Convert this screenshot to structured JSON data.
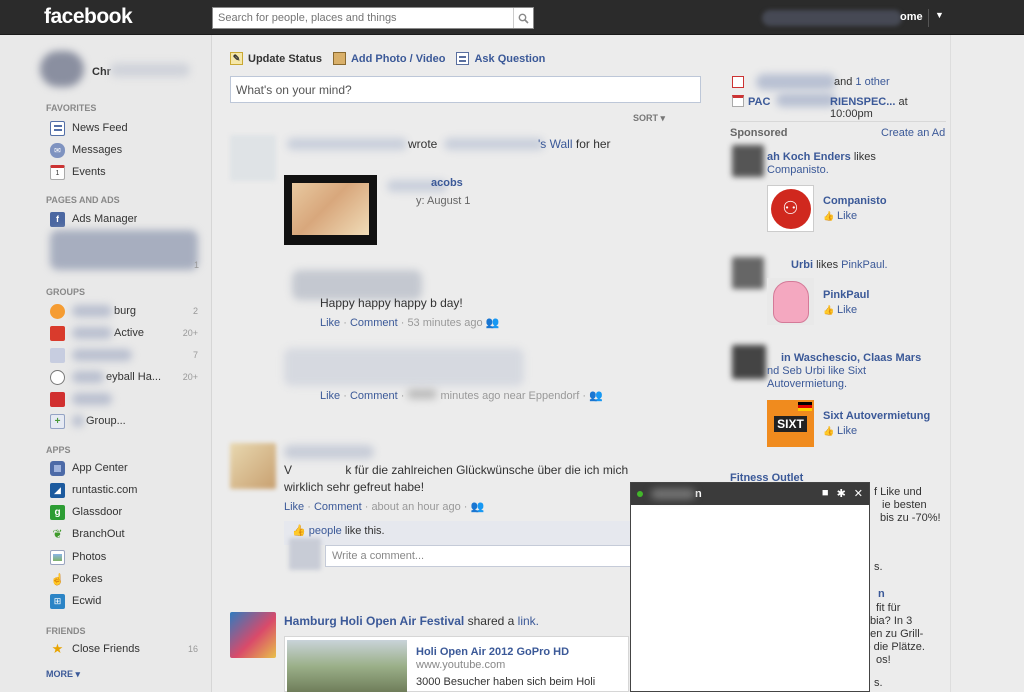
{
  "header": {
    "logo": "facebook",
    "search_placeholder": "Search for people, places and things",
    "home_label": "ome"
  },
  "profile": {
    "name_fragment": "Chr"
  },
  "sidebar": {
    "favorites_head": "FAVORITES",
    "favorites": [
      {
        "label": "News Feed"
      },
      {
        "label": "Messages"
      },
      {
        "label": "Events"
      }
    ],
    "pages_head": "PAGES AND ADS",
    "ads_manager": "Ads Manager",
    "pages_count": "1",
    "groups_head": "GROUPS",
    "groups": [
      {
        "label": "burg",
        "count": "2"
      },
      {
        "label": "Active",
        "count": "20+"
      },
      {
        "label": "",
        "count": "7"
      },
      {
        "label": "eyball Ha...",
        "count": "20+"
      },
      {
        "label": "",
        "count": ""
      },
      {
        "label": "Group...",
        "count": ""
      }
    ],
    "apps_head": "APPS",
    "apps": [
      {
        "label": "App Center"
      },
      {
        "label": "runtastic.com"
      },
      {
        "label": "Glassdoor"
      },
      {
        "label": "BranchOut"
      },
      {
        "label": "Photos"
      },
      {
        "label": "Pokes"
      },
      {
        "label": "Ecwid"
      }
    ],
    "friends_head": "FRIENDS",
    "friends": [
      {
        "label": "Close Friends",
        "count": "16"
      }
    ],
    "more": "MORE"
  },
  "composer": {
    "update_status": "Update Status",
    "add_photo": "Add Photo / Video",
    "ask_question": "Ask Question",
    "placeholder": "What's on your mind?",
    "sort": "SORT"
  },
  "feed": {
    "post1": {
      "wrote": "wrote",
      "wall_suffix": "'s Wall",
      "for_her": "for her",
      "name_fragment": "acobs",
      "bday_fragment": "y: August 1",
      "message": "Happy happy happy b day!",
      "like": "Like",
      "comment": "Comment",
      "time": "53 minutes ago",
      "like2": "Like",
      "comment2": "Comment",
      "time2": "minutes ago near Eppendorf"
    },
    "post2": {
      "message_line1": "V                k für die zahlreichen Glückwünsche über die ich mich",
      "message_line2": "wirklich sehr gefreut habe!",
      "like": "Like",
      "comment": "Comment",
      "time": "about an hour ago",
      "people_like": "people",
      "like_this": "like this.",
      "write_comment": "Write a comment..."
    },
    "post3": {
      "page": "Hamburg Holi Open Air Festival",
      "shared": "shared a",
      "link": "link.",
      "link_title": "Holi Open Air 2012 GoPro HD",
      "link_site": "www.youtube.com",
      "link_desc": "3000 Besucher haben sich beim Holi"
    }
  },
  "right": {
    "event1": "and",
    "event1_link": "1 other",
    "event2": "PAC",
    "event2_rest": "RIENSPEC...",
    "event2_time": "at 10:00pm",
    "sponsored": "Sponsored",
    "create_ad": "Create an Ad",
    "ad1_who": "ah Koch Enders",
    "ad1_likes": "likes",
    "ad1_page": "Companisto.",
    "ad1_title": "Companisto",
    "ad1_like": "Like",
    "ad2_who": "Urbi",
    "ad2_likes": "likes",
    "ad2_page": "PinkPaul.",
    "ad2_title": "PinkPaul",
    "ad2_like": "Like",
    "ad3_line1": "in Waschescio, Claas Mars",
    "ad3_line2": "nd Seb Urbi like Sixt",
    "ad3_line3": "Autovermietung.",
    "ad3_title": "Sixt Autovermietung",
    "ad3_like": "Like",
    "fitness": "Fitness Outlet",
    "fitness_l1": "f Like und",
    "fitness_l2": "ie besten",
    "fitness_l3": "bis zu -70%!",
    "frag1": "s.",
    "frag2": "n",
    "frag3": "fit für",
    "frag4": "bia? In 3",
    "frag5": "nen zu Grill-",
    "frag6": "ie die Plätze.",
    "frag7": "os!",
    "frag8": "s."
  },
  "chat": {
    "name_fragment": "n"
  },
  "colors": {
    "brand": "#3b5998",
    "topbar": "#2b2b2b"
  }
}
